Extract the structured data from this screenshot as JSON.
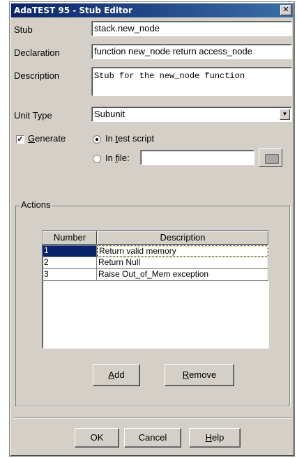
{
  "window": {
    "title": "AdaTEST 95 - Stub Editor",
    "close_glyph": "✕"
  },
  "form": {
    "stub_label": "Stub",
    "stub_value": "stack.new_node",
    "declaration_label": "Declaration",
    "declaration_value": "function new_node return access_node",
    "description_label": "Description",
    "description_value": "Stub for the new_node function",
    "unit_type_label": "Unit Type",
    "unit_type_value": "Subunit",
    "generate_label_pre": "",
    "generate_label_ul": "G",
    "generate_label_post": "enerate",
    "generate_checked": true,
    "in_test_script_pre": "In ",
    "in_test_script_ul": "t",
    "in_test_script_post": "est script",
    "in_file_pre": "In ",
    "in_file_ul": "f",
    "in_file_post": "ile:",
    "in_file_value": ""
  },
  "actions": {
    "group_title": "Actions",
    "columns": [
      "Number",
      "Description"
    ],
    "rows": [
      {
        "number": "1",
        "description": "Return valid memory"
      },
      {
        "number": "2",
        "description": "Return Null"
      },
      {
        "number": "3",
        "description": "Raise Out_of_Mem exception"
      }
    ],
    "add_ul": "A",
    "add_rest": "dd",
    "remove_ul": "R",
    "remove_rest": "emove"
  },
  "footer": {
    "ok_label": "OK",
    "cancel_label": "Cancel",
    "help_ul": "H",
    "help_rest": "elp"
  },
  "colors": {
    "title_start": "#0a246a",
    "title_end": "#3a6ea5",
    "dialog_bg": "#d4d0c8",
    "selection": "#0a246a"
  },
  "icons": {
    "close": "close-icon",
    "checkbox": "check-icon",
    "combo": "chevron-down-icon",
    "browse": "folder-icon"
  }
}
